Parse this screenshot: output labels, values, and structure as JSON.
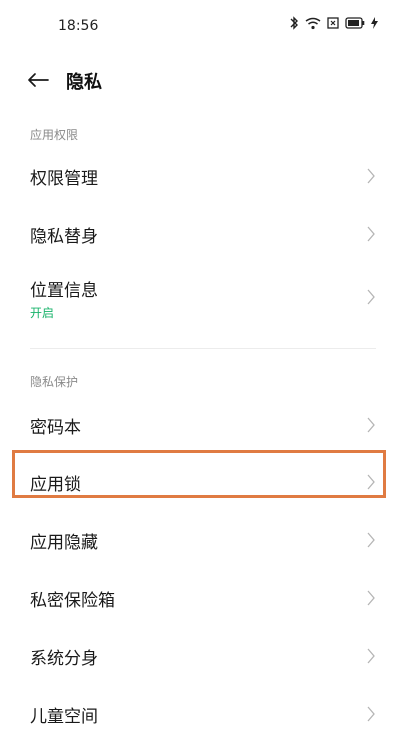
{
  "status_bar": {
    "time": "18:56",
    "icons": [
      "bluetooth-icon",
      "wifi-icon",
      "sim-icon",
      "battery-icon",
      "charging-icon"
    ]
  },
  "header": {
    "title": "隐私"
  },
  "sections": [
    {
      "label": "应用权限",
      "items": [
        {
          "label": "权限管理"
        },
        {
          "label": "隐私替身"
        },
        {
          "label": "位置信息",
          "sub": "开启"
        }
      ]
    },
    {
      "label": "隐私保护",
      "items": [
        {
          "label": "密码本"
        },
        {
          "label": "应用锁",
          "highlighted": true
        },
        {
          "label": "应用隐藏"
        },
        {
          "label": "私密保险箱"
        },
        {
          "label": "系统分身"
        },
        {
          "label": "儿童空间"
        }
      ]
    }
  ],
  "colors": {
    "accent_green": "#19b36b",
    "highlight_border": "#e07b42",
    "section_label": "#8a8a8a"
  }
}
